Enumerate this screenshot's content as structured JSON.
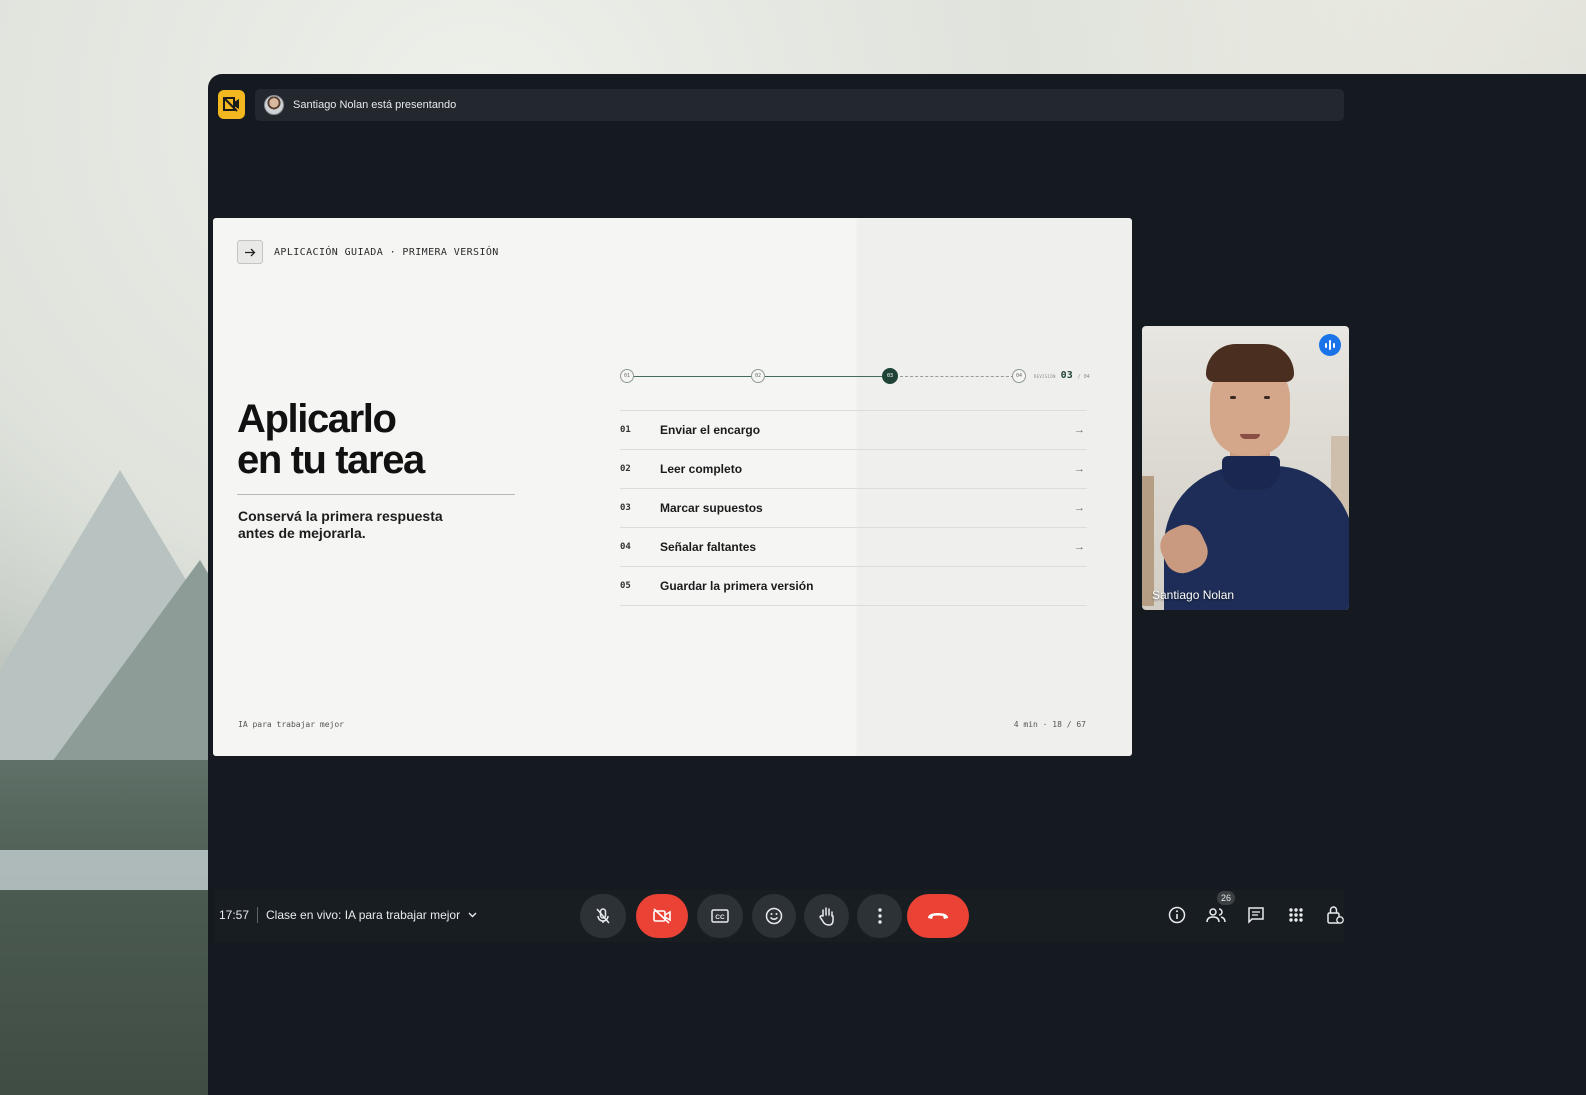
{
  "presenter_bar": {
    "text": "Santiago Nolan está presentando"
  },
  "slide": {
    "tag": "APLICACIÓN GUIADA · PRIMERA VERSIÓN",
    "title_line1": "Aplicarlo",
    "title_line2": "en tu tarea",
    "subtitle": "Conservá la primera respuesta antes de mejorarla.",
    "progress": {
      "nodes": [
        "01",
        "02",
        "03",
        "04"
      ],
      "active": "03",
      "label": "REVISIÓN",
      "current": "03",
      "total": "/ 04"
    },
    "steps": [
      {
        "num": "01",
        "label": "Enviar el encargo",
        "arrow": true
      },
      {
        "num": "02",
        "label": "Leer completo",
        "arrow": true
      },
      {
        "num": "03",
        "label": "Marcar supuestos",
        "arrow": true
      },
      {
        "num": "04",
        "label": "Señalar faltantes",
        "arrow": true
      },
      {
        "num": "05",
        "label": "Guardar la primera versión",
        "arrow": false
      }
    ],
    "footer_left": "IA para trabajar mejor",
    "footer_right": "4 min · 18 / 67"
  },
  "participant": {
    "name": "Santiago Nolan",
    "speaking": true
  },
  "call_bar": {
    "time": "17:57",
    "meeting_title": "Clase en vivo: IA para trabajar mejor",
    "participants_count": "26"
  },
  "colors": {
    "accent_green": "#1f4437",
    "end_call_red": "#ea4335",
    "logo_yellow": "#f3b81f",
    "speaking_blue": "#1a73e8"
  },
  "icons": [
    "app-logo-icon",
    "arrow-right-icon",
    "mic-off-icon",
    "camera-off-icon",
    "captions-icon",
    "emoji-icon",
    "raise-hand-icon",
    "more-options-icon",
    "end-call-icon",
    "info-icon",
    "people-icon",
    "chat-icon",
    "activities-icon",
    "host-controls-icon",
    "chevron-down-icon",
    "speaking-indicator-icon"
  ]
}
